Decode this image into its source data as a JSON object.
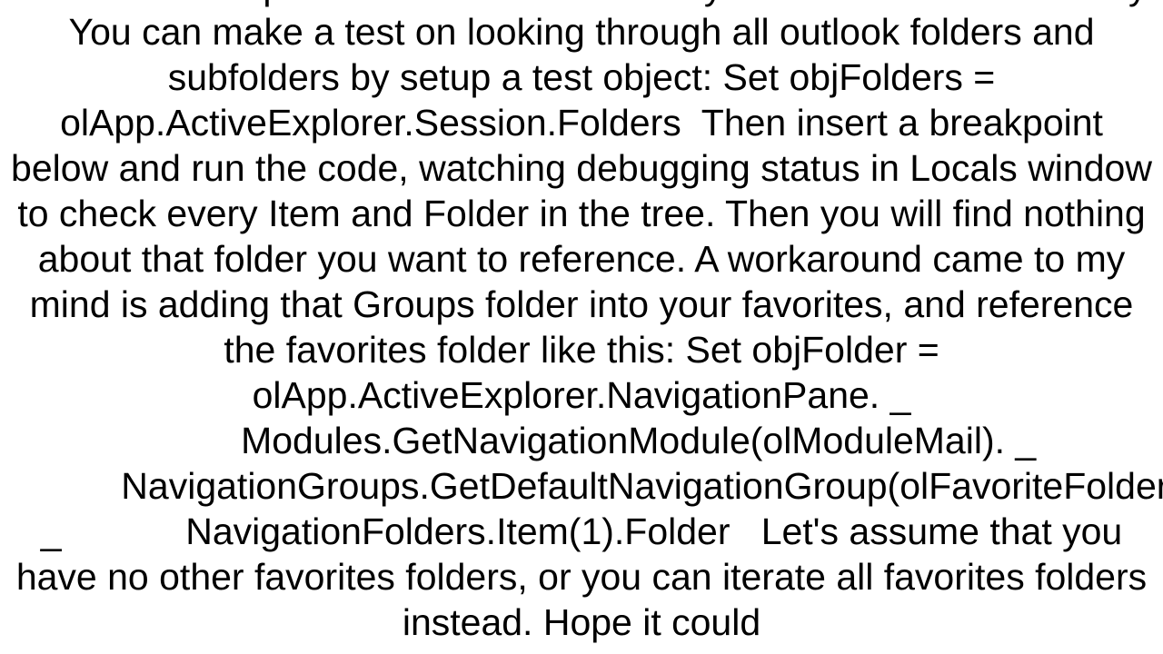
{
  "document": {
    "body_text": "is that the Groups folder is not accessed by the Folders stored locally. You can make a test on looking through all outlook folders and subfolders by setup a test object: Set objFolders = olApp.ActiveExplorer.Session.Folders  Then insert a breakpoint below and run the code, watching debugging status in Locals window to check every Item and Folder in the tree. Then you will find nothing about that folder you want to reference. A workaround came to my mind is adding that Groups folder into your favorites, and reference the favorites folder like this: Set objFolder = olApp.ActiveExplorer.NavigationPane. _            Modules.GetNavigationModule(olModuleMail). _            NavigationGroups.GetDefaultNavigationGroup(olFavoriteFoldersGroup). _            NavigationFolders.Item(1).Folder   Let's assume that you have no other favorites folders, or you can iterate all favorites folders instead. Hope it could"
  }
}
